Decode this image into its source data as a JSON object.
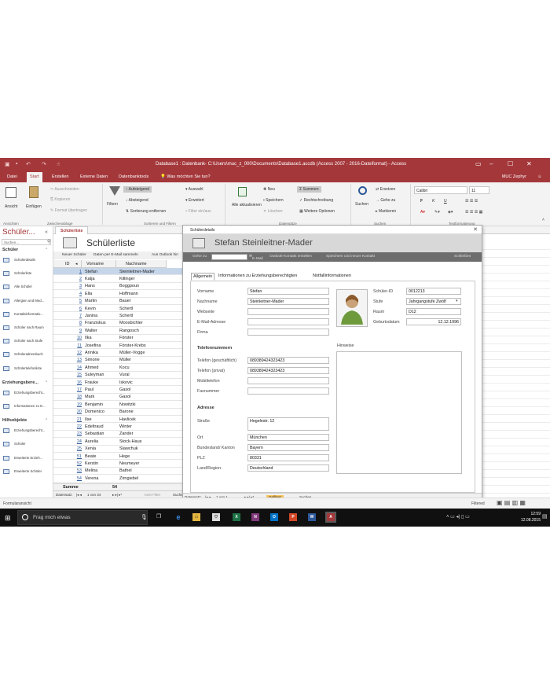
{
  "window": {
    "title": "Database1 : Datenbank- C:\\Users\\muc_z_000\\Documents\\Database1.accdb (Access 2007 - 2016-Dateiformat) - Access",
    "user": "MUC Zephyr",
    "help_icon": "question-icon"
  },
  "ribbon_tabs": [
    "Datei",
    "Start",
    "Erstellen",
    "Externe Daten",
    "Datenbanktools",
    "Was möchten Sie tun?"
  ],
  "ribbon": {
    "views": {
      "view": "Ansicht",
      "paste": "Einfügen",
      "group": "Ansichten",
      "clipboard": "Zwischenablage"
    },
    "clipboard": {
      "cut": "Ausschneiden",
      "copy": "Kopieren",
      "format": "Format übertragen"
    },
    "sort": {
      "filter": "Filtern",
      "asc": "Aufsteigend",
      "desc": "Absteigend",
      "remove": "Sortierung entfernen",
      "selection": "Auswahl",
      "advanced": "Erweitert",
      "toggle": "Filter ein/aus",
      "group": "Sortieren und Filtern"
    },
    "records": {
      "refresh": "Alle aktualisieren",
      "new": "Neu",
      "save": "Speichern",
      "delete": "Löschen",
      "totals": "Summen",
      "spelling": "Rechtschreibung",
      "more": "Weitere Optionen",
      "group": "Datensätze"
    },
    "find": {
      "find": "Suchen",
      "replace": "Ersetzen",
      "goto": "Gehe zu",
      "select": "Markieren",
      "group": "Suchen"
    },
    "text": {
      "font": "Calibri",
      "size": "11",
      "bold": "F",
      "italic": "K",
      "underline": "U",
      "group": "Textformatierung"
    }
  },
  "nav": {
    "title": "Schüler...",
    "search_placeholder": "Suchen...",
    "categories": [
      {
        "label": "Schüler",
        "items": [
          "Schülerdetails",
          "Schülerliste",
          "Alle Schüler",
          "Allergien und Med...",
          "Kontaktinformatio...",
          "Schüler nach Raum",
          "Schüler nach Stufe",
          "Schüleradressbuch",
          "Schülertelefonliste"
        ]
      },
      {
        "label": "Erziehungsbere...",
        "items": [
          "Erziehungsberecht...",
          "Informationen zu E..."
        ]
      },
      {
        "label": "Hilfsobjekte",
        "items": [
          "Erziehungsberecht...",
          "Schüler",
          "Erweiterte Erzieh...",
          "Erweiterte Schüler"
        ]
      }
    ]
  },
  "doc_tab": "Schülerliste",
  "list": {
    "title": "Schülerliste",
    "links": [
      "Neuer Schüler",
      "Daten per E-Mail sammeln",
      "Aus Outlook hin"
    ],
    "columns": [
      "ID",
      "Vorname",
      "Nachname"
    ],
    "rows": [
      [
        "1",
        "Stefan",
        "Steinleitner-Mader"
      ],
      [
        "2",
        "Katja",
        "Killinger"
      ],
      [
        "3",
        "Hans",
        "Boggpoun"
      ],
      [
        "4",
        "Ella",
        "Hoffmann"
      ],
      [
        "5",
        "Martin",
        "Bauer"
      ],
      [
        "6",
        "Kevin",
        "Schertl"
      ],
      [
        "7",
        "Janina",
        "Schertl"
      ],
      [
        "8",
        "Franziskus",
        "Moosbichler"
      ],
      [
        "9",
        "Walter",
        "Rangosch"
      ],
      [
        "10",
        "Ilka",
        "Förster"
      ],
      [
        "11",
        "Josefina",
        "Förster-Krebs"
      ],
      [
        "12",
        "Annika",
        "Müller-Vogge"
      ],
      [
        "13",
        "Simone",
        "Müller"
      ],
      [
        "14",
        "Ahmed",
        "Kocu"
      ],
      [
        "15",
        "Suleyman",
        "Vural"
      ],
      [
        "16",
        "Frauke",
        "Iskovic"
      ],
      [
        "17",
        "Paul",
        "Gasol"
      ],
      [
        "18",
        "Mark",
        "Gasol"
      ],
      [
        "19",
        "Benjamin",
        "Nowitzki"
      ],
      [
        "20",
        "Domenico",
        "Barone"
      ],
      [
        "21",
        "Ilse",
        "Havlicek"
      ],
      [
        "22",
        "Edeltraud",
        "Winter"
      ],
      [
        "23",
        "Sebastian",
        "Zander"
      ],
      [
        "24",
        "Aurelia",
        "Stock-Haus"
      ],
      [
        "25",
        "Xenia",
        "Slawchuk"
      ],
      [
        "51",
        "Beate",
        "Hege"
      ],
      [
        "52",
        "Kerstin",
        "Neumeyer"
      ],
      [
        "53",
        "Melina",
        "Bathel"
      ],
      [
        "54",
        "Verena",
        "Zirngiebel"
      ]
    ],
    "sum_label": "Summe",
    "sum_value": "54",
    "recnav": {
      "label": "Datensatz:",
      "pos": "1 von 34",
      "filter": "Kein Filter",
      "search": "Suchen"
    }
  },
  "dialog": {
    "caption": "Schülerdetails",
    "heading": "Stefan Steinleitner-Mader",
    "bar": {
      "goto": "Gehe zu",
      "email": "E-Mail",
      "outlook": "Outlook-Kontakt erstellen",
      "save_new": "Speichern und neuer Kontakt",
      "close": "Schließen"
    },
    "tabs": [
      "Allgemein",
      "Informationen zu Erziehungsberechtigten",
      "Notfallinformationen"
    ],
    "fields": {
      "vorname": {
        "label": "Vorname",
        "value": "Stefan"
      },
      "nachname": {
        "label": "Nachname",
        "value": "Steinleitner-Mader"
      },
      "webseite": {
        "label": "Webseite",
        "value": ""
      },
      "email": {
        "label": "E-Mail-Adresse",
        "value": ""
      },
      "firma": {
        "label": "Firma",
        "value": ""
      },
      "schueler_id": {
        "label": "Schüler-ID",
        "value": "0012213"
      },
      "stufe": {
        "label": "Stufe",
        "value": "Jahrgangstufe Zwölf"
      },
      "raum": {
        "label": "Raum",
        "value": "D12"
      },
      "geburtsdatum": {
        "label": "Geburtsdatum",
        "value": "12.12.1996"
      },
      "hinweise": {
        "label": "Hinweise"
      }
    },
    "phones": {
      "title": "Telefonnummern",
      "work": {
        "label": "Telefon (geschäftlich)",
        "value": "089389424323423"
      },
      "private": {
        "label": "Telefon (privat)",
        "value": "089389424323423"
      },
      "mobile": {
        "label": "Mobiltelefon",
        "value": ""
      },
      "fax": {
        "label": "Faxnummer",
        "value": ""
      }
    },
    "address": {
      "title": "Adresse",
      "street": {
        "label": "Straße",
        "value": "Hegelestr. 12"
      },
      "city": {
        "label": "Ort",
        "value": "München"
      },
      "state": {
        "label": "Bundesland/ Kanton",
        "value": "Bayern"
      },
      "zip": {
        "label": "PLZ",
        "value": "80331"
      },
      "country": {
        "label": "Land/Region",
        "value": "Deutschland"
      }
    },
    "recnav": {
      "label": "Datensatz:",
      "pos": "1 von 1",
      "filter": "Gefiltert",
      "search": "Suchen"
    }
  },
  "status": {
    "left": "Formularansicht",
    "right": "Filtered"
  },
  "taskbar": {
    "search": "Frag mich etwas",
    "time": "12:59",
    "date": "12.08.2015",
    "apps": [
      "X",
      "N",
      "O",
      "P",
      "W",
      "A"
    ]
  },
  "colors": {
    "accent": "#a4373a"
  }
}
